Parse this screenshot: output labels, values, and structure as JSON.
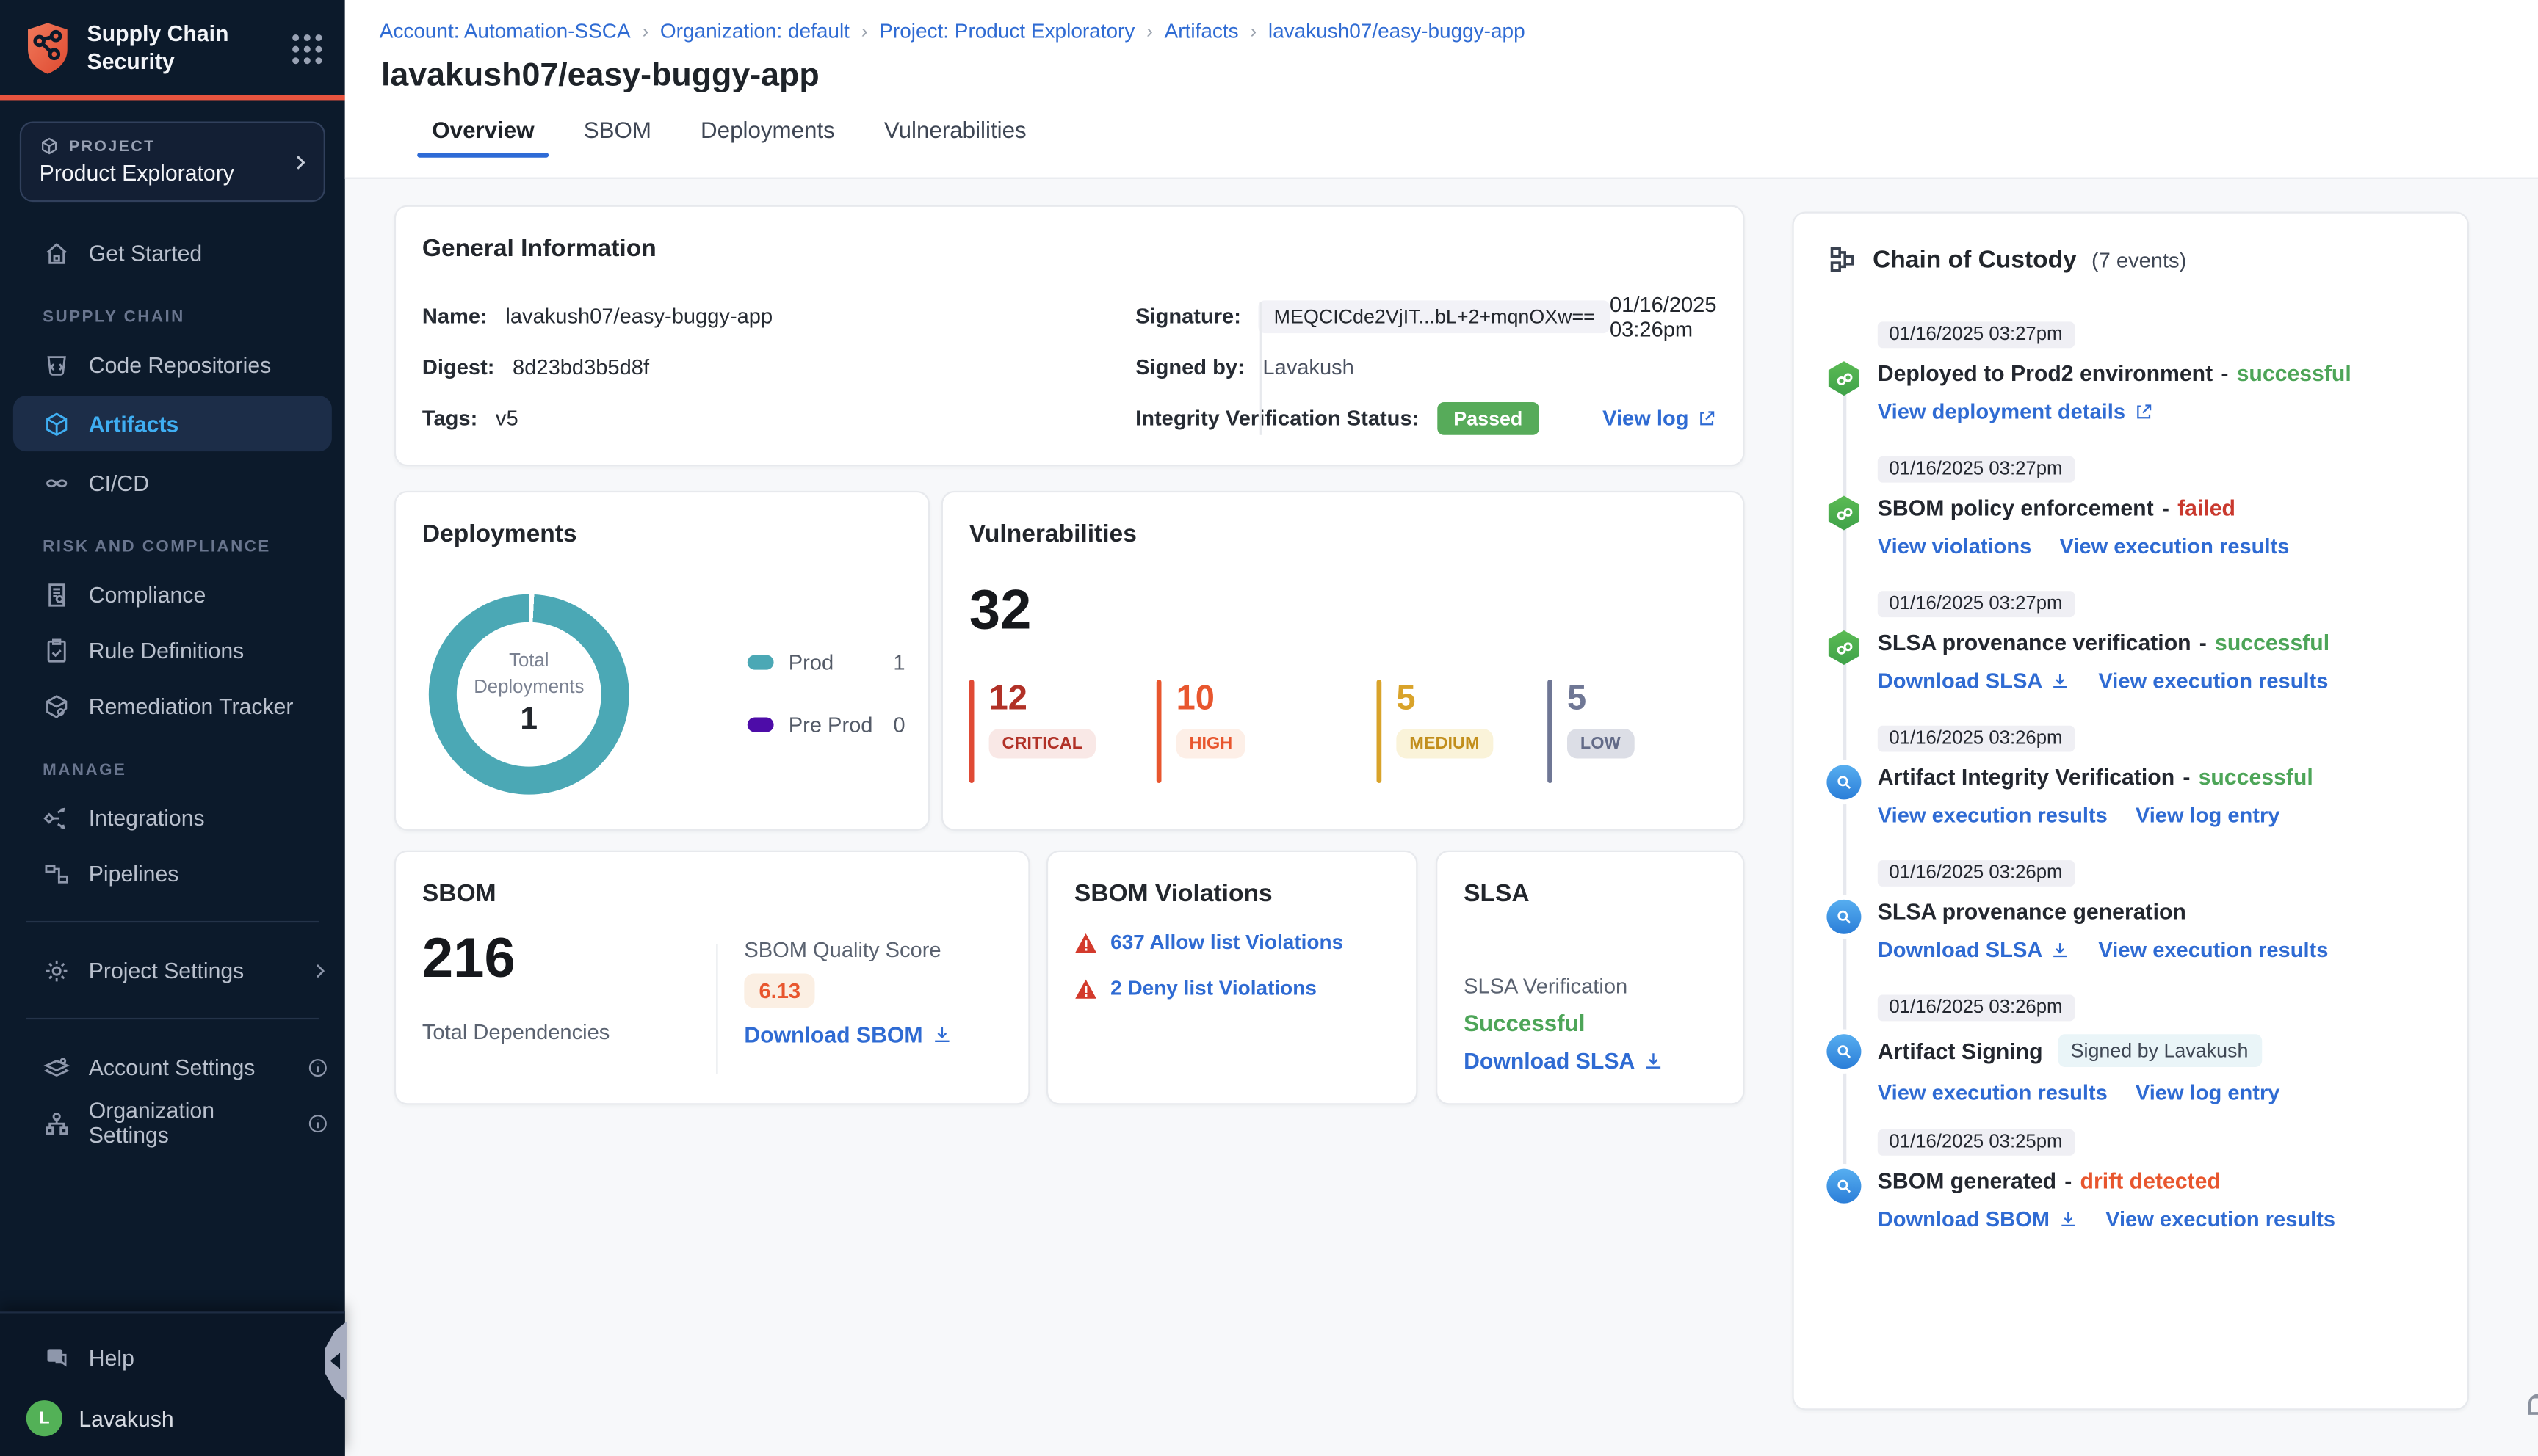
{
  "brand": {
    "title": "Supply Chain Security"
  },
  "project_selector": {
    "label": "PROJECT",
    "value": "Product Exploratory"
  },
  "sidebar": {
    "get_started": "Get Started",
    "sections": [
      {
        "label": "SUPPLY CHAIN",
        "items": [
          {
            "label": "Code Repositories"
          },
          {
            "label": "Artifacts",
            "active": true
          },
          {
            "label": "CI/CD"
          }
        ]
      },
      {
        "label": "RISK AND COMPLIANCE",
        "items": [
          {
            "label": "Compliance"
          },
          {
            "label": "Rule Definitions"
          },
          {
            "label": "Remediation Tracker"
          }
        ]
      },
      {
        "label": "MANAGE",
        "items": [
          {
            "label": "Integrations"
          },
          {
            "label": "Pipelines"
          }
        ]
      }
    ],
    "project_settings": "Project Settings",
    "account_settings": "Account Settings",
    "organization_settings": "Organization Settings",
    "help": "Help",
    "user": {
      "name": "Lavakush",
      "initial": "L"
    }
  },
  "breadcrumb": {
    "separator": "›",
    "items": [
      "Account: Automation-SSCA",
      "Organization: default",
      "Project: Product Exploratory",
      "Artifacts",
      "lavakush07/easy-buggy-app"
    ]
  },
  "page": {
    "title": "lavakush07/easy-buggy-app"
  },
  "tabs": [
    {
      "label": "Overview"
    },
    {
      "label": "SBOM"
    },
    {
      "label": "Deployments"
    },
    {
      "label": "Vulnerabilities"
    }
  ],
  "general_info": {
    "title": "General Information",
    "name_label": "Name:",
    "name": "lavakush07/easy-buggy-app",
    "digest_label": "Digest:",
    "digest": "8d23bd3b5d8f",
    "tags_label": "Tags:",
    "tags": "v5",
    "signature_label": "Signature:",
    "signature": "MEQCICde2VjIT...bL+2+mqnOXw==",
    "signature_date": "01/16/2025 03:26pm",
    "signed_by_label": "Signed by:",
    "signed_by": "Lavakush",
    "integrity_label": "Integrity Verification Status:",
    "integrity_status": "Passed",
    "view_log": "View log"
  },
  "deployments": {
    "title": "Deployments",
    "center_label_1": "Total",
    "center_label_2": "Deployments",
    "total": "1",
    "legend": [
      {
        "label": "Prod",
        "value": "1"
      },
      {
        "label": "Pre Prod",
        "value": "0"
      }
    ]
  },
  "vulnerabilities": {
    "title": "Vulnerabilities",
    "total": "32",
    "items": [
      {
        "count": "12",
        "label": "CRITICAL"
      },
      {
        "count": "10",
        "label": "HIGH"
      },
      {
        "count": "5",
        "label": "MEDIUM"
      },
      {
        "count": "5",
        "label": "LOW"
      }
    ]
  },
  "sbom": {
    "title": "SBOM",
    "total": "216",
    "total_label": "Total Dependencies",
    "quality_label": "SBOM Quality Score",
    "score": "6.13",
    "download": "Download SBOM"
  },
  "sbom_violations": {
    "title": "SBOM Violations",
    "items": [
      {
        "label": "637 Allow list Violations"
      },
      {
        "label": "2 Deny list Violations"
      }
    ]
  },
  "slsa": {
    "title": "SLSA",
    "verification_label": "SLSA Verification",
    "status": "Successful",
    "download": "Download SLSA"
  },
  "chain": {
    "title": "Chain of Custody",
    "count": "(7 events)",
    "events": [
      {
        "timestamp": "01/16/2025 03:27pm",
        "title": "Deployed to Prod2 environment",
        "sep": "-",
        "status": "successful",
        "links": [
          {
            "label": "View deployment details"
          }
        ]
      },
      {
        "timestamp": "01/16/2025 03:27pm",
        "title": "SBOM policy enforcement",
        "sep": "-",
        "status": "failed",
        "links": [
          {
            "label": "View violations"
          },
          {
            "label": "View execution results"
          }
        ]
      },
      {
        "timestamp": "01/16/2025 03:27pm",
        "title": "SLSA provenance verification",
        "sep": "-",
        "status": "successful",
        "links": [
          {
            "label": "Download SLSA"
          },
          {
            "label": "View execution results"
          }
        ]
      },
      {
        "timestamp": "01/16/2025 03:26pm",
        "title": "Artifact Integrity Verification",
        "sep": "-",
        "status": "successful",
        "links": [
          {
            "label": "View execution results"
          },
          {
            "label": "View log entry"
          }
        ]
      },
      {
        "timestamp": "01/16/2025 03:26pm",
        "title": "SLSA provenance generation",
        "links": [
          {
            "label": "Download SLSA"
          },
          {
            "label": "View execution results"
          }
        ]
      },
      {
        "timestamp": "01/16/2025 03:26pm",
        "title": "Artifact Signing",
        "badge": "Signed by Lavakush",
        "links": [
          {
            "label": "View execution results"
          },
          {
            "label": "View log entry"
          }
        ]
      },
      {
        "timestamp": "01/16/2025 03:25pm",
        "title": "SBOM generated",
        "sep": "-",
        "status": "drift detected",
        "links": [
          {
            "label": "Download SBOM"
          },
          {
            "label": "View execution results"
          }
        ]
      }
    ]
  },
  "colors": {
    "accent_orange": "#E8543F",
    "link_blue": "#2F6BD3",
    "nav_active_blue": "#3FAEF2",
    "success_green": "#4DA558",
    "passed_badge_green": "#57AB5A",
    "failed_red": "#C9392E",
    "drift_orange": "#E8562E",
    "donut_teal": "#4BA8B5",
    "preprod_purple": "#4D0CA8",
    "critical": "#B13127",
    "high": "#E8562E",
    "medium": "#D9A32A",
    "low": "#6F7795",
    "sidebar_bg": "#0C1A2B",
    "avatar_green": "#53B157"
  },
  "chart_data": [
    {
      "type": "pie",
      "title": "Deployments",
      "labels": [
        "Prod",
        "Pre Prod"
      ],
      "values": [
        1,
        0
      ],
      "colors": [
        "#4BA8B5",
        "#4D0CA8"
      ],
      "center_label": "Total Deployments",
      "total": 1,
      "legend_position": "right"
    },
    {
      "type": "bar",
      "title": "Vulnerabilities",
      "categories": [
        "Critical",
        "High",
        "Medium",
        "Low"
      ],
      "values": [
        12,
        10,
        5,
        5
      ],
      "total": 32
    }
  ]
}
